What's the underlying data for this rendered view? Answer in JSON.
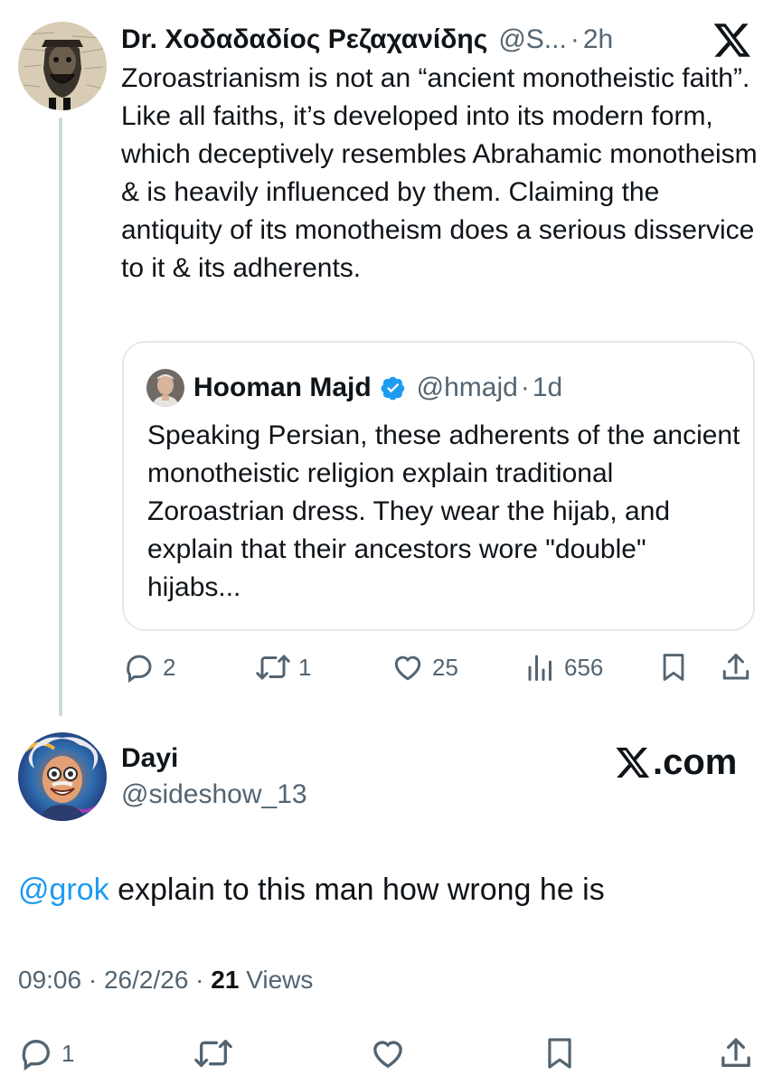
{
  "tweet": {
    "author_name": "Dr. Χοδαδαδίος Ρεζαχανίδης",
    "author_handle": "@S...",
    "separator": "·",
    "time": "2h",
    "text": "Zoroastrianism is not an “ancient monotheistic faith”. Like all faiths, it’s developed into its modern form, which deceptively resembles Abrahamic monotheism & is heavily influenced by them. Claiming the antiquity of its monotheism does a serious disservice to it & its adherents.",
    "quote": {
      "author_name": "Hooman Majd",
      "author_handle": "@hmajd",
      "separator": "·",
      "time": "1d",
      "text": "Speaking Persian, these adherents of the ancient monotheistic religion explain traditional Zoroastrian dress. They wear the hijab, and explain that their ancestors wore \"double\" hijabs..."
    },
    "actions": {
      "replies": "2",
      "reposts": "1",
      "likes": "25",
      "views": "656"
    }
  },
  "reply": {
    "author_name": "Dayi",
    "author_handle": "@sideshow_13",
    "mention": "@grok",
    "text": " explain to this man how wrong he is",
    "time": "09:06",
    "date": "26/2/26",
    "meta_separator": "·",
    "views_count": "21",
    "views_label": "Views",
    "actions": {
      "replies": "1"
    }
  },
  "watermark": {
    "text": ".com"
  },
  "icons": {
    "top_right": "x-logo-icon",
    "reply": "reply-icon",
    "repost": "repost-icon",
    "like": "heart-icon",
    "views": "views-icon",
    "bookmark": "bookmark-icon",
    "share": "share-icon",
    "verified": "verified-badge-icon"
  },
  "colors": {
    "text_primary": "#0f1419",
    "text_secondary": "#536471",
    "link": "#1d9bf0",
    "verified": "#1d9bf0",
    "border": "#e5e9ec"
  }
}
